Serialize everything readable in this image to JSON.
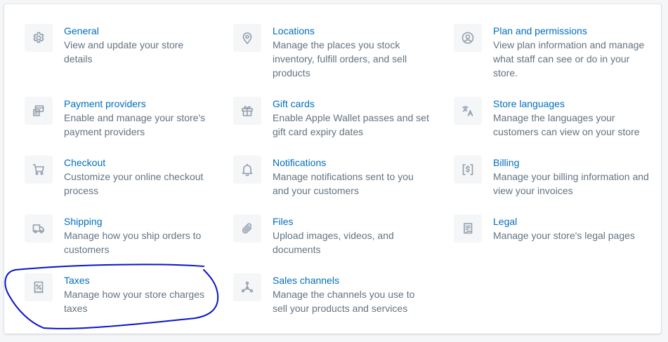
{
  "settings": {
    "items": [
      {
        "title": "General",
        "description": "View and update your store details",
        "icon": "gear-icon"
      },
      {
        "title": "Locations",
        "description": "Manage the places you stock inventory, fulfill orders, and sell products",
        "icon": "location-pin-icon"
      },
      {
        "title": "Plan and permissions",
        "description": "View plan information and manage what staff can see or do in your store.",
        "icon": "user-circle-icon"
      },
      {
        "title": "Payment providers",
        "description": "Enable and manage your store's payment providers",
        "icon": "payment-icon"
      },
      {
        "title": "Gift cards",
        "description": "Enable Apple Wallet passes and set gift card expiry dates",
        "icon": "gift-icon"
      },
      {
        "title": "Store languages",
        "description": "Manage the languages your customers can view on your store",
        "icon": "translate-icon"
      },
      {
        "title": "Checkout",
        "description": "Customize your online checkout process",
        "icon": "cart-icon"
      },
      {
        "title": "Notifications",
        "description": "Manage notifications sent to you and your customers",
        "icon": "bell-icon"
      },
      {
        "title": "Billing",
        "description": "Manage your billing information and view your invoices",
        "icon": "billing-icon"
      },
      {
        "title": "Shipping",
        "description": "Manage how you ship orders to customers",
        "icon": "truck-icon"
      },
      {
        "title": "Files",
        "description": "Upload images, videos, and documents",
        "icon": "paperclip-icon"
      },
      {
        "title": "Legal",
        "description": "Manage your store's legal pages",
        "icon": "legal-document-icon"
      },
      {
        "title": "Taxes",
        "description": "Manage how your store charges taxes",
        "icon": "tax-receipt-icon"
      },
      {
        "title": "Sales channels",
        "description": "Manage the channels you use to sell your products and services",
        "icon": "channels-icon"
      }
    ]
  },
  "colors": {
    "link": "#006fbb",
    "description": "#637381",
    "icon": "#919eab",
    "annotation": "#0a14c8"
  }
}
